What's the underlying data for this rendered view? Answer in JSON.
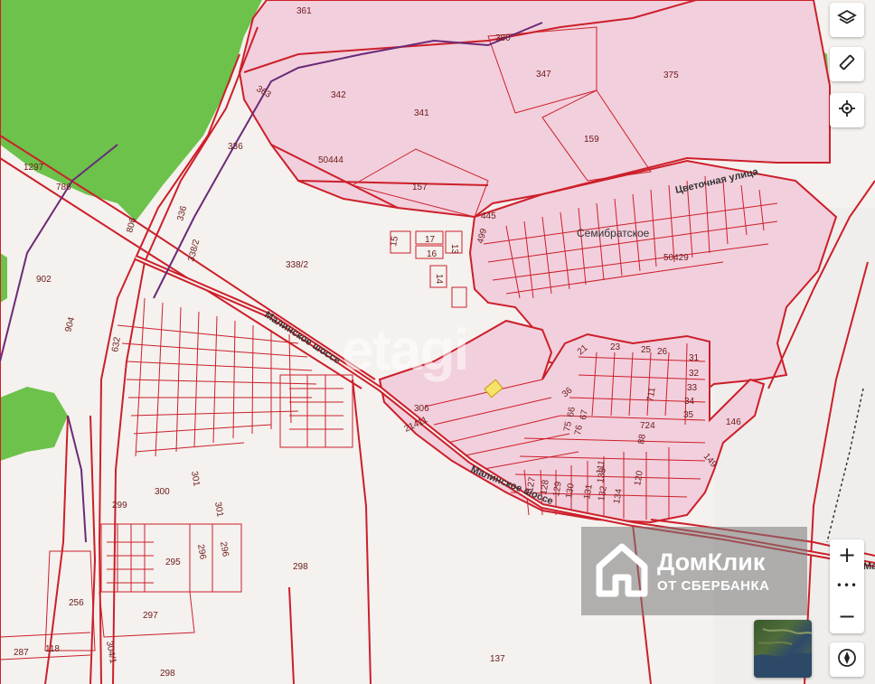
{
  "map": {
    "parcels": [
      {
        "label": "361"
      },
      {
        "label": "380"
      },
      {
        "label": "347"
      },
      {
        "label": "375"
      },
      {
        "label": "363"
      },
      {
        "label": "342"
      },
      {
        "label": "341"
      },
      {
        "label": "159"
      },
      {
        "label": "336"
      },
      {
        "label": "50444"
      },
      {
        "label": "157"
      },
      {
        "label": "1297"
      },
      {
        "label": "786"
      },
      {
        "label": "336"
      },
      {
        "label": "806"
      },
      {
        "label": "445"
      },
      {
        "label": "15"
      },
      {
        "label": "17"
      },
      {
        "label": "13"
      },
      {
        "label": "16"
      },
      {
        "label": "338/2"
      },
      {
        "label": "338/2"
      },
      {
        "label": "14"
      },
      {
        "label": "499"
      },
      {
        "label": "902"
      },
      {
        "label": "904"
      },
      {
        "label": "632"
      },
      {
        "label": "50429"
      },
      {
        "label": "21"
      },
      {
        "label": "23"
      },
      {
        "label": "25"
      },
      {
        "label": "26"
      },
      {
        "label": "31"
      },
      {
        "label": "32"
      },
      {
        "label": "33"
      },
      {
        "label": "34"
      },
      {
        "label": "35"
      },
      {
        "label": "36"
      },
      {
        "label": "711"
      },
      {
        "label": "306"
      },
      {
        "label": "21411"
      },
      {
        "label": "75"
      },
      {
        "label": "76"
      },
      {
        "label": "66"
      },
      {
        "label": "67"
      },
      {
        "label": "724"
      },
      {
        "label": "88"
      },
      {
        "label": "146"
      },
      {
        "label": "149"
      },
      {
        "label": "127"
      },
      {
        "label": "128"
      },
      {
        "label": "129"
      },
      {
        "label": "130"
      },
      {
        "label": "131"
      },
      {
        "label": "132"
      },
      {
        "label": "133"
      },
      {
        "label": "111"
      },
      {
        "label": "134"
      },
      {
        "label": "120"
      },
      {
        "label": "299"
      },
      {
        "label": "300"
      },
      {
        "label": "301"
      },
      {
        "label": "301"
      },
      {
        "label": "296"
      },
      {
        "label": "296"
      },
      {
        "label": "295"
      },
      {
        "label": "298"
      },
      {
        "label": "256"
      },
      {
        "label": "297"
      },
      {
        "label": "287"
      },
      {
        "label": "118"
      },
      {
        "label": "304/1"
      },
      {
        "label": "298"
      },
      {
        "label": "137"
      }
    ],
    "roads": {
      "road_1": "Малинское шоссе",
      "road_2": "Малинское шоссе",
      "street": "Цветочная улица",
      "edge_label": "Ма"
    },
    "place": "Семибратское",
    "watermark": "etagi"
  },
  "controls": {
    "layers": {
      "icon": "layers-icon"
    },
    "ruler": {
      "icon": "ruler-icon"
    },
    "locate": {
      "icon": "locate-icon"
    },
    "zoom_in": "+",
    "more": "•••",
    "zoom_out": "−",
    "compass": {
      "icon": "compass-icon"
    }
  },
  "brand": {
    "name": "ДомКлик",
    "subtitle": "ОТ СБЕРБАНКА",
    "icon": "house-logo-icon"
  },
  "colors": {
    "parcel_line": "#cc1f2a",
    "highlight_fill": "#f2cfdc",
    "forest": "#6cc24a",
    "background": "#f4f1ee"
  }
}
